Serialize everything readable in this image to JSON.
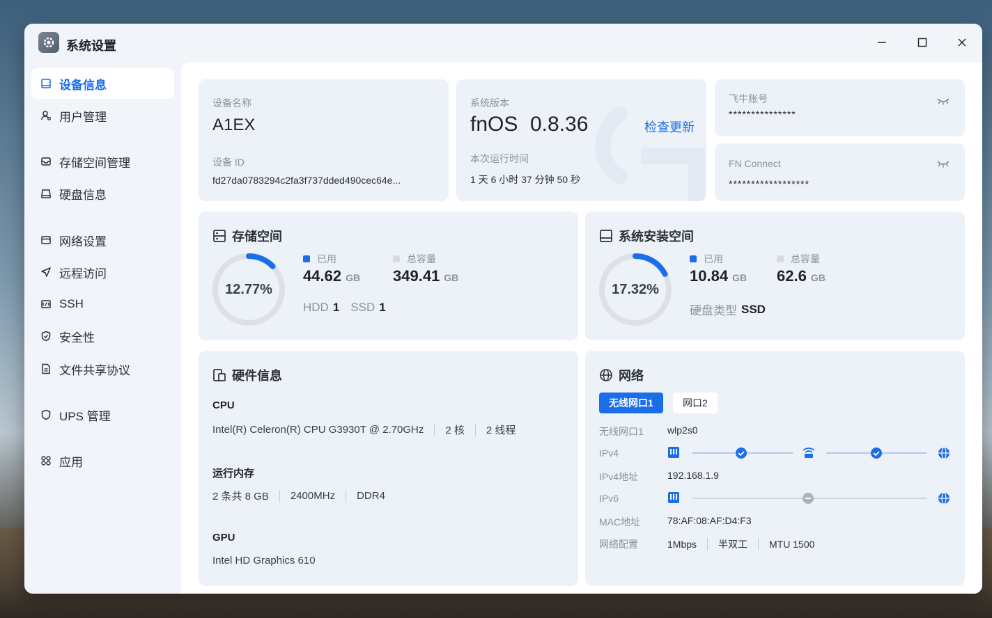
{
  "window": {
    "title": "系统设置",
    "icon": "gear-icon"
  },
  "titlebar_controls": {
    "minimize": "−",
    "maximize": "□",
    "close": "✕"
  },
  "sidebar": {
    "items": [
      {
        "label": "设备信息",
        "icon": "device-info-icon",
        "active": true
      },
      {
        "label": "用户管理",
        "icon": "user-icon"
      },
      {
        "label": "存储空间管理",
        "icon": "storage-icon"
      },
      {
        "label": "硬盘信息",
        "icon": "disk-icon"
      },
      {
        "label": "网络设置",
        "icon": "network-settings-icon"
      },
      {
        "label": "远程访问",
        "icon": "remote-access-icon"
      },
      {
        "label": "SSH",
        "icon": "ssh-icon"
      },
      {
        "label": "安全性",
        "icon": "shield-icon"
      },
      {
        "label": "文件共享协议",
        "icon": "file-share-icon"
      },
      {
        "label": "UPS 管理",
        "icon": "ups-shield-icon"
      },
      {
        "label": "应用",
        "icon": "apps-icon"
      }
    ]
  },
  "device": {
    "name_label": "设备名称",
    "name": "A1EX",
    "id_label": "设备 ID",
    "id": "fd27da0783294c2fa3f737dded490cec64e..."
  },
  "system": {
    "version_label": "系统版本",
    "os": "fnOS",
    "version": "0.8.36",
    "check_update": "检查更新",
    "uptime_label": "本次运行时间",
    "uptime": "1 天 6 小时 37 分钟 50 秒"
  },
  "accounts": {
    "feiniu_label": "飞牛账号",
    "feiniu_value": "***************",
    "fnconnect_label": "FN Connect",
    "fnconnect_value": "******************"
  },
  "storage": {
    "title": "存储空间",
    "percent_text": "12.77%",
    "percent": 12.77,
    "used_label": "已用",
    "used": "44.62",
    "used_unit": "GB",
    "total_label": "总容量",
    "total": "349.41",
    "total_unit": "GB",
    "hdd_label": "HDD",
    "hdd_count": "1",
    "ssd_label": "SSD",
    "ssd_count": "1"
  },
  "system_space": {
    "title": "系统安装空间",
    "percent_text": "17.32%",
    "percent": 17.32,
    "used_label": "已用",
    "used": "10.84",
    "used_unit": "GB",
    "total_label": "总容量",
    "total": "62.6",
    "total_unit": "GB",
    "disk_type_label": "硬盘类型",
    "disk_type": "SSD"
  },
  "hardware": {
    "title": "硬件信息",
    "cpu_label": "CPU",
    "cpu_model": "Intel(R) Celeron(R) CPU G3930T @ 2.70GHz",
    "cpu_cores": "2 核",
    "cpu_threads": "2 线程",
    "mem_label": "运行内存",
    "mem_size": "2 条共 8 GB",
    "mem_freq": "2400MHz",
    "mem_type": "DDR4",
    "gpu_label": "GPU",
    "gpu_model": "Intel HD Graphics 610"
  },
  "network": {
    "title": "网络",
    "tabs": [
      "无线网口1",
      "网口2"
    ],
    "iface_label": "无线网口1",
    "iface_value": "wlp2s0",
    "ipv4_label": "IPv4",
    "ipv4_addr_label": "IPv4地址",
    "ipv4_addr": "192.168.1.9",
    "ipv6_label": "IPv6",
    "mac_label": "MAC地址",
    "mac": "78:AF:08:AF:D4:F3",
    "config_label": "网络配置",
    "speed": "1Mbps",
    "duplex": "半双工",
    "mtu": "MTU 1500"
  },
  "colors": {
    "accent": "#1c6ee8",
    "ring_track": "#dde1e7",
    "card_bg": "#edf2f8",
    "ok_node": "#1c6ee8",
    "pending_node": "#aab4c0"
  }
}
